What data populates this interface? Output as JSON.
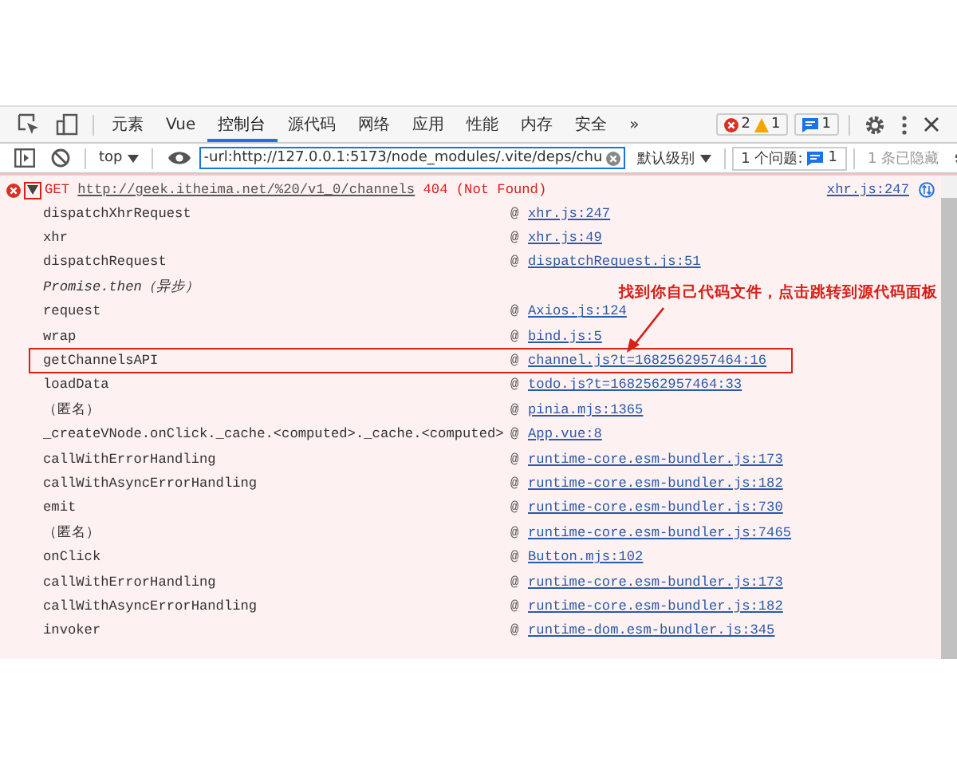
{
  "tabs": [
    {
      "label": "元素",
      "selected": false
    },
    {
      "label": "Vue",
      "selected": false
    },
    {
      "label": "控制台",
      "selected": true
    },
    {
      "label": "源代码",
      "selected": false
    },
    {
      "label": "网络",
      "selected": false
    },
    {
      "label": "应用",
      "selected": false
    },
    {
      "label": "性能",
      "selected": false
    },
    {
      "label": "内存",
      "selected": false
    },
    {
      "label": "安全",
      "selected": false
    },
    {
      "label": "»",
      "selected": false
    }
  ],
  "counts": {
    "errors": "2",
    "warnings": "1",
    "messages": "1"
  },
  "toolbar": {
    "context": "top",
    "filter": "-url:http://127.0.0.1:5173/node_modules/.vite/deps/chu",
    "level": "默认级别",
    "issues_label": "1 个问题:",
    "issues_count": "1",
    "hidden": "1 条已隐藏"
  },
  "error": {
    "method": "GET",
    "url": "http://geek.itheima.net/%20/v1_0/channels",
    "status": "404 (Not Found)",
    "source": "xhr.js:247",
    "expanded": true,
    "marked": true
  },
  "stack": [
    {
      "kind": "frame",
      "function": "dispatchXhrRequest",
      "at": "@",
      "source": "xhr.js:247",
      "highlighted": false
    },
    {
      "kind": "frame",
      "function": "xhr",
      "at": "@",
      "source": "xhr.js:49",
      "highlighted": false
    },
    {
      "kind": "frame",
      "function": "dispatchRequest",
      "at": "@",
      "source": "dispatchRequest.js:51",
      "highlighted": false
    },
    {
      "kind": "async",
      "function": "Promise.then（异步）",
      "highlighted": false
    },
    {
      "kind": "frame",
      "function": "request",
      "at": "@",
      "source": "Axios.js:124",
      "highlighted": false
    },
    {
      "kind": "frame",
      "function": "wrap",
      "at": "@",
      "source": "bind.js:5",
      "highlighted": false
    },
    {
      "kind": "frame",
      "function": "getChannelsAPI",
      "at": "@",
      "source": "channel.js?t=1682562957464:16",
      "highlighted": true
    },
    {
      "kind": "frame",
      "function": "loadData",
      "at": "@",
      "source": "todo.js?t=1682562957464:33",
      "highlighted": false
    },
    {
      "kind": "frame",
      "function": "（匿名）",
      "at": "@",
      "source": "pinia.mjs:1365",
      "highlighted": false
    },
    {
      "kind": "frame",
      "function": "_createVNode.onClick._cache.<computed>._cache.<computed>",
      "at": "@",
      "source": "App.vue:8",
      "highlighted": false
    },
    {
      "kind": "frame",
      "function": "callWithErrorHandling",
      "at": "@",
      "source": "runtime-core.esm-bundler.js:173",
      "highlighted": false
    },
    {
      "kind": "frame",
      "function": "callWithAsyncErrorHandling",
      "at": "@",
      "source": "runtime-core.esm-bundler.js:182",
      "highlighted": false
    },
    {
      "kind": "frame",
      "function": "emit",
      "at": "@",
      "source": "runtime-core.esm-bundler.js:730",
      "highlighted": false
    },
    {
      "kind": "frame",
      "function": "（匿名）",
      "at": "@",
      "source": "runtime-core.esm-bundler.js:7465",
      "highlighted": false
    },
    {
      "kind": "frame",
      "function": "onClick",
      "at": "@",
      "source": "Button.mjs:102",
      "highlighted": false
    },
    {
      "kind": "frame",
      "function": "callWithErrorHandling",
      "at": "@",
      "source": "runtime-core.esm-bundler.js:173",
      "highlighted": false
    },
    {
      "kind": "frame",
      "function": "callWithAsyncErrorHandling",
      "at": "@",
      "source": "runtime-core.esm-bundler.js:182",
      "highlighted": false
    },
    {
      "kind": "frame",
      "function": "invoker",
      "at": "@",
      "source": "runtime-dom.esm-bundler.js:345",
      "highlighted": false
    }
  ],
  "annotation": "找到你自己代码文件，点击跳转到源代码面板"
}
